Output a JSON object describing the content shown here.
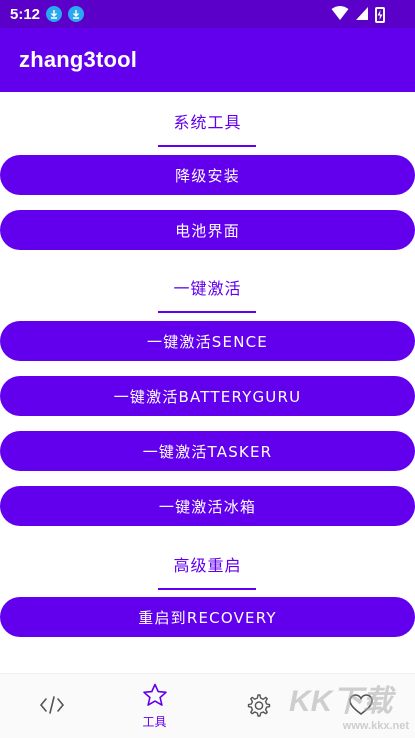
{
  "status_bar": {
    "time": "5:12",
    "icons": [
      "download-icon",
      "download-icon",
      "wifi-icon",
      "signal-icon",
      "battery-charging-icon"
    ]
  },
  "app_bar": {
    "title": "zhang3tool"
  },
  "sections": [
    {
      "header": "系统工具",
      "buttons": [
        "降级安装",
        "电池界面"
      ]
    },
    {
      "header": "一键激活",
      "buttons": [
        "一键激活SENCE",
        "一键激活BATTERYGURU",
        "一键激活TASKER",
        "一键激活冰箱"
      ]
    },
    {
      "header": "高级重启",
      "buttons": [
        "重启到RECOVERY"
      ]
    }
  ],
  "bottom_nav": {
    "items": [
      {
        "icon": "code-icon",
        "label": ""
      },
      {
        "icon": "star-icon",
        "label": "工具",
        "active": true
      },
      {
        "icon": "gear-icon",
        "label": ""
      },
      {
        "icon": "heart-icon",
        "label": ""
      }
    ]
  },
  "watermark": {
    "brand": "KK下载",
    "url": "www.kkx.net"
  },
  "colors": {
    "primary": "#6200ee",
    "status_bar": "#5a00c8",
    "download_badge": "#2aa8f0"
  }
}
